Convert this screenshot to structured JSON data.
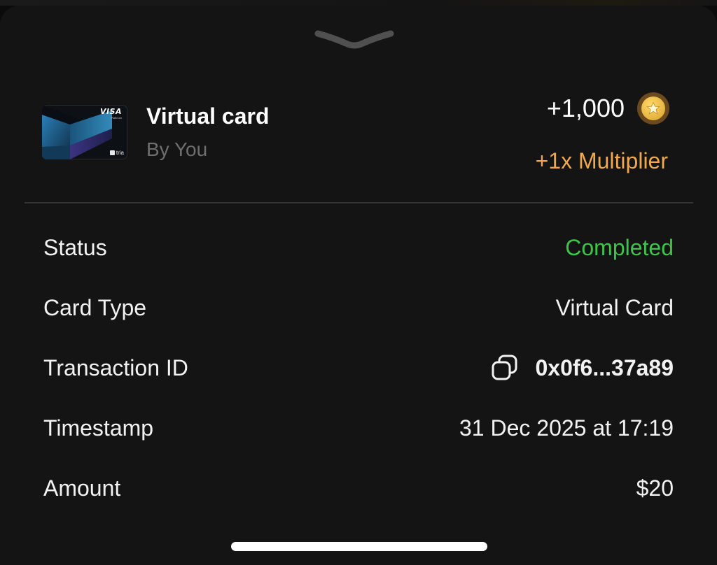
{
  "header": {
    "title": "Virtual card",
    "subtitle": "By You",
    "points": "+1,000",
    "multiplier": "+1x Multiplier",
    "card_brand": "VISA",
    "card_brand_sub": "Platinum",
    "card_issuer": "tria"
  },
  "details": [
    {
      "label": "Status",
      "value": "Completed"
    },
    {
      "label": "Card Type",
      "value": "Virtual Card"
    },
    {
      "label": "Transaction ID",
      "value": "0x0f6...37a89"
    },
    {
      "label": "Timestamp",
      "value": "31 Dec 2025 at 17:19"
    },
    {
      "label": "Amount",
      "value": "$20"
    }
  ],
  "icons": {
    "grabber": "chevron-down-icon",
    "coin": "star-coin-icon",
    "copy": "copy-icon"
  },
  "colors": {
    "background": "#141414",
    "status_completed": "#3ec44a",
    "multiplier": "#f0a84e",
    "muted": "#6e6e6e"
  }
}
